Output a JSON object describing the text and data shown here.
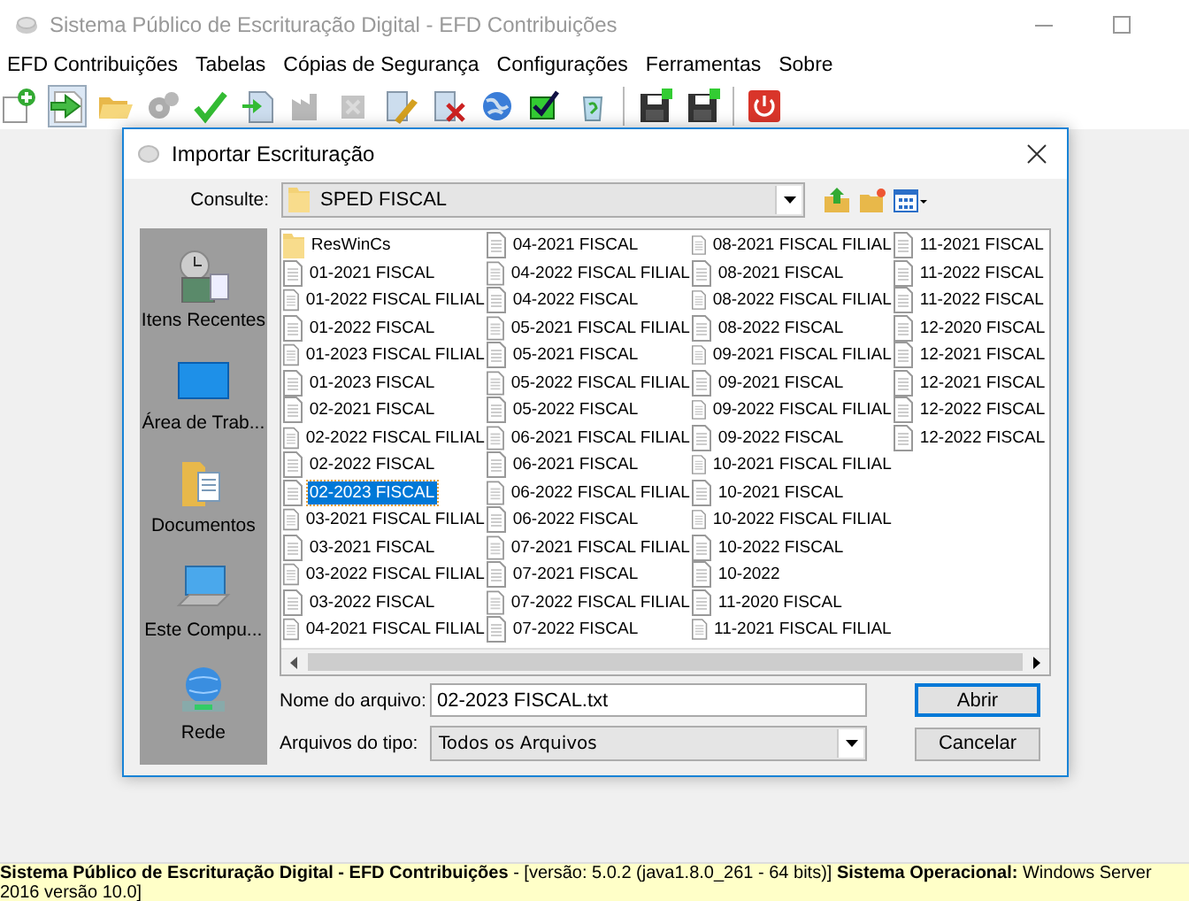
{
  "window": {
    "title": "Sistema Público de Escrituração Digital - EFD Contribuições"
  },
  "menu": [
    "EFD Contribuições",
    "Tabelas",
    "Cópias de Segurança",
    "Configurações",
    "Ferramentas",
    "Sobre"
  ],
  "toolbar": [
    {
      "kind": "button",
      "disabled": false,
      "pressed": false
    },
    {
      "kind": "button",
      "disabled": false,
      "pressed": true
    },
    {
      "kind": "button",
      "disabled": false,
      "pressed": false
    },
    {
      "kind": "button",
      "disabled": true,
      "pressed": false
    },
    {
      "kind": "button",
      "disabled": false,
      "pressed": false
    },
    {
      "kind": "button",
      "disabled": false,
      "pressed": false
    },
    {
      "kind": "button",
      "disabled": true,
      "pressed": false
    },
    {
      "kind": "button",
      "disabled": true,
      "pressed": false
    },
    {
      "kind": "button",
      "disabled": false,
      "pressed": false
    },
    {
      "kind": "button",
      "disabled": false,
      "pressed": false
    },
    {
      "kind": "button",
      "disabled": false,
      "pressed": false
    },
    {
      "kind": "button",
      "disabled": false,
      "pressed": false
    },
    {
      "kind": "button",
      "disabled": false,
      "pressed": false
    },
    {
      "kind": "separator"
    },
    {
      "kind": "button",
      "disabled": false,
      "pressed": false
    },
    {
      "kind": "button",
      "disabled": false,
      "pressed": false
    },
    {
      "kind": "separator"
    },
    {
      "kind": "button",
      "disabled": false,
      "pressed": false
    }
  ],
  "dialog": {
    "title": "Importar Escrituração",
    "look_in": {
      "label": "Consulte:",
      "value": "SPED FISCAL"
    },
    "places": [
      "Itens Recentes",
      "Área de Trab...",
      "Documentos",
      "Este Compu...",
      "Rede"
    ],
    "files": [
      {
        "name": "ResWinCs",
        "kind": "folder",
        "selected": false
      },
      {
        "name": "01-2021 FISCAL",
        "kind": "file",
        "selected": false
      },
      {
        "name": "01-2022 FISCAL FILIAL",
        "kind": "file",
        "selected": false
      },
      {
        "name": "01-2022 FISCAL",
        "kind": "file",
        "selected": false
      },
      {
        "name": "01-2023 FISCAL FILIAL",
        "kind": "file",
        "selected": false
      },
      {
        "name": "01-2023 FISCAL",
        "kind": "file",
        "selected": false
      },
      {
        "name": "02-2021 FISCAL",
        "kind": "file",
        "selected": false
      },
      {
        "name": "02-2022 FISCAL FILIAL",
        "kind": "file",
        "selected": false
      },
      {
        "name": "02-2022 FISCAL",
        "kind": "file",
        "selected": false
      },
      {
        "name": "02-2023 FISCAL",
        "kind": "file",
        "selected": true
      },
      {
        "name": "03-2021 FISCAL FILIAL",
        "kind": "file",
        "selected": false
      },
      {
        "name": "03-2021 FISCAL",
        "kind": "file",
        "selected": false
      },
      {
        "name": "03-2022 FISCAL FILIAL",
        "kind": "file",
        "selected": false
      },
      {
        "name": "03-2022 FISCAL",
        "kind": "file",
        "selected": false
      },
      {
        "name": "04-2021 FISCAL FILIAL",
        "kind": "file",
        "selected": false
      },
      {
        "name": "04-2021 FISCAL",
        "kind": "file",
        "selected": false
      },
      {
        "name": "04-2022 FISCAL FILIAL",
        "kind": "file",
        "selected": false
      },
      {
        "name": "04-2022 FISCAL",
        "kind": "file",
        "selected": false
      },
      {
        "name": "05-2021 FISCAL FILIAL",
        "kind": "file",
        "selected": false
      },
      {
        "name": "05-2021 FISCAL",
        "kind": "file",
        "selected": false
      },
      {
        "name": "05-2022 FISCAL FILIAL",
        "kind": "file",
        "selected": false
      },
      {
        "name": "05-2022 FISCAL",
        "kind": "file",
        "selected": false
      },
      {
        "name": "06-2021 FISCAL FILIAL",
        "kind": "file",
        "selected": false
      },
      {
        "name": "06-2021 FISCAL",
        "kind": "file",
        "selected": false
      },
      {
        "name": "06-2022 FISCAL FILIAL",
        "kind": "file",
        "selected": false
      },
      {
        "name": "06-2022 FISCAL",
        "kind": "file",
        "selected": false
      },
      {
        "name": "07-2021 FISCAL FILIAL",
        "kind": "file",
        "selected": false
      },
      {
        "name": "07-2021 FISCAL",
        "kind": "file",
        "selected": false
      },
      {
        "name": "07-2022 FISCAL FILIAL",
        "kind": "file",
        "selected": false
      },
      {
        "name": "07-2022 FISCAL",
        "kind": "file",
        "selected": false
      },
      {
        "name": "08-2021 FISCAL FILIAL",
        "kind": "file",
        "selected": false
      },
      {
        "name": "08-2021 FISCAL",
        "kind": "file",
        "selected": false
      },
      {
        "name": "08-2022 FISCAL FILIAL",
        "kind": "file",
        "selected": false
      },
      {
        "name": "08-2022 FISCAL",
        "kind": "file",
        "selected": false
      },
      {
        "name": "09-2021 FISCAL FILIAL",
        "kind": "file",
        "selected": false
      },
      {
        "name": "09-2021 FISCAL",
        "kind": "file",
        "selected": false
      },
      {
        "name": "09-2022 FISCAL FILIAL",
        "kind": "file",
        "selected": false
      },
      {
        "name": "09-2022 FISCAL",
        "kind": "file",
        "selected": false
      },
      {
        "name": "10-2021 FISCAL FILIAL",
        "kind": "file",
        "selected": false
      },
      {
        "name": "10-2021 FISCAL",
        "kind": "file",
        "selected": false
      },
      {
        "name": "10-2022 FISCAL FILIAL",
        "kind": "file",
        "selected": false
      },
      {
        "name": "10-2022 FISCAL",
        "kind": "file",
        "selected": false
      },
      {
        "name": "10-2022",
        "kind": "file",
        "selected": false
      },
      {
        "name": "11-2020 FISCAL",
        "kind": "file",
        "selected": false
      },
      {
        "name": "11-2021 FISCAL FILIAL",
        "kind": "file",
        "selected": false
      },
      {
        "name": "11-2021 FISCAL",
        "kind": "file",
        "selected": false
      },
      {
        "name": "11-2022 FISCAL",
        "kind": "file",
        "selected": false
      },
      {
        "name": "11-2022 FISCAL",
        "kind": "file",
        "selected": false
      },
      {
        "name": "12-2020 FISCAL",
        "kind": "file",
        "selected": false
      },
      {
        "name": "12-2021 FISCAL",
        "kind": "file",
        "selected": false
      },
      {
        "name": "12-2021 FISCAL",
        "kind": "file",
        "selected": false
      },
      {
        "name": "12-2022 FISCAL",
        "kind": "file",
        "selected": false
      },
      {
        "name": "12-2022 FISCAL",
        "kind": "file",
        "selected": false
      }
    ],
    "file_name": {
      "label": "Nome do arquivo:",
      "value": "02-2023 FISCAL.txt"
    },
    "file_type": {
      "label": "Arquivos do tipo:",
      "value": "Todos os Arquivos"
    },
    "buttons": [
      {
        "label": "Abrir",
        "default": true
      },
      {
        "label": "Cancelar",
        "default": false
      }
    ]
  },
  "status_bar": "**Sistema Público de Escrituração Digital - EFD Contribuições** - [versão: 5.0.2 (java1.8.0_261 - 64 bits)] **Sistema Operacional:** Windows Server 2016 versão 10.0]"
}
